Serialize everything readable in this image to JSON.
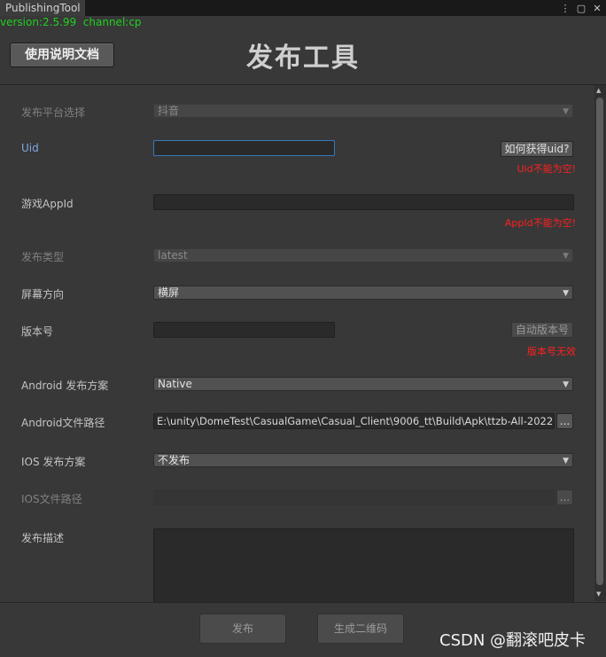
{
  "window": {
    "tab": "PublishingTool",
    "icons": [
      "kebab-menu-icon",
      "maximize-icon",
      "close-icon"
    ]
  },
  "version_line": "version:2.5.99  channel:cp",
  "doc_button": "使用说明文档",
  "title": "发布工具",
  "form": {
    "platform": {
      "label": "发布平台选择",
      "value": "抖音"
    },
    "uid": {
      "label": "Uid",
      "value": "",
      "button": "如何获得uid?",
      "error": "Uid不能为空!"
    },
    "appid": {
      "label": "游戏AppId",
      "value": "",
      "error": "AppId不能为空!"
    },
    "publish_type": {
      "label": "发布类型",
      "value": "latest"
    },
    "orientation": {
      "label": "屏幕方向",
      "value": "横屏"
    },
    "version_no": {
      "label": "版本号",
      "value": "",
      "button": "自动版本号",
      "error": "版本号无效"
    },
    "android_plan": {
      "label": "Android 发布方案",
      "value": "Native"
    },
    "android_path": {
      "label": "Android文件路径",
      "value": "E:\\unity\\DomeTest\\CasualGame\\Casual_Client\\9006_tt\\Build\\Apk\\ttzb-All-2022",
      "browse": "..."
    },
    "ios_plan": {
      "label": "IOS 发布方案",
      "value": "不发布"
    },
    "ios_path": {
      "label": "IOS文件路径",
      "value": "",
      "browse": "..."
    },
    "description": {
      "label": "发布描述",
      "value": ""
    }
  },
  "footer": {
    "publish": "发布",
    "qrcode": "生成二维码"
  },
  "watermark": "CSDN @翻滚吧皮卡",
  "colors": {
    "background": "#383838",
    "version_text": "#20d020",
    "error_text": "#ff2020",
    "focus_border": "#3a79bb"
  }
}
